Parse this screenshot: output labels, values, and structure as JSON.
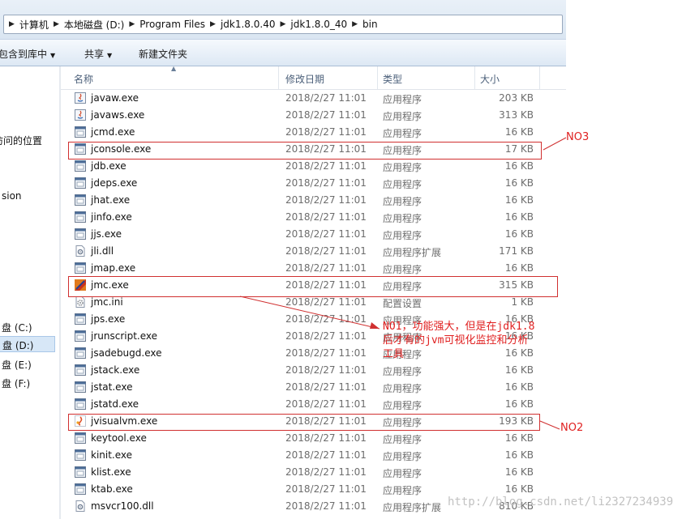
{
  "address": {
    "crumbs": [
      "计算机",
      "本地磁盘 (D:)",
      "Program Files",
      "jdk1.8.0.40",
      "jdk1.8.0_40",
      "bin"
    ]
  },
  "toolbar": {
    "include_library": "包含到库中",
    "share": "共享",
    "new_folder": "新建文件夹"
  },
  "nav": {
    "recent_places": "访问的位置",
    "version": "sion",
    "drive_c": "盘 (C:)",
    "drive_d": "盘 (D:)",
    "drive_e": "盘 (E:)",
    "drive_f": "盘 (F:)"
  },
  "columns": {
    "name": "名称",
    "modified": "修改日期",
    "type": "类型",
    "size": "大小"
  },
  "files": [
    {
      "name": "javaw.exe",
      "date": "2018/2/27 11:01",
      "type": "应用程序",
      "size": "203 KB",
      "icon": "java-icon"
    },
    {
      "name": "javaws.exe",
      "date": "2018/2/27 11:01",
      "type": "应用程序",
      "size": "313 KB",
      "icon": "java-icon"
    },
    {
      "name": "jcmd.exe",
      "date": "2018/2/27 11:01",
      "type": "应用程序",
      "size": "16 KB",
      "icon": "exe-icon"
    },
    {
      "name": "jconsole.exe",
      "date": "2018/2/27 11:01",
      "type": "应用程序",
      "size": "17 KB",
      "icon": "exe-icon"
    },
    {
      "name": "jdb.exe",
      "date": "2018/2/27 11:01",
      "type": "应用程序",
      "size": "16 KB",
      "icon": "exe-icon"
    },
    {
      "name": "jdeps.exe",
      "date": "2018/2/27 11:01",
      "type": "应用程序",
      "size": "16 KB",
      "icon": "exe-icon"
    },
    {
      "name": "jhat.exe",
      "date": "2018/2/27 11:01",
      "type": "应用程序",
      "size": "16 KB",
      "icon": "exe-icon"
    },
    {
      "name": "jinfo.exe",
      "date": "2018/2/27 11:01",
      "type": "应用程序",
      "size": "16 KB",
      "icon": "exe-icon"
    },
    {
      "name": "jjs.exe",
      "date": "2018/2/27 11:01",
      "type": "应用程序",
      "size": "16 KB",
      "icon": "exe-icon"
    },
    {
      "name": "jli.dll",
      "date": "2018/2/27 11:01",
      "type": "应用程序扩展",
      "size": "171 KB",
      "icon": "dll-icon"
    },
    {
      "name": "jmap.exe",
      "date": "2018/2/27 11:01",
      "type": "应用程序",
      "size": "16 KB",
      "icon": "exe-icon"
    },
    {
      "name": "jmc.exe",
      "date": "2018/2/27 11:01",
      "type": "应用程序",
      "size": "315 KB",
      "icon": "jmc-icon"
    },
    {
      "name": "jmc.ini",
      "date": "2018/2/27 11:01",
      "type": "配置设置",
      "size": "1 KB",
      "icon": "ini-icon"
    },
    {
      "name": "jps.exe",
      "date": "2018/2/27 11:01",
      "type": "应用程序",
      "size": "16 KB",
      "icon": "exe-icon"
    },
    {
      "name": "jrunscript.exe",
      "date": "2018/2/27 11:01",
      "type": "应用程序",
      "size": "16 KB",
      "icon": "exe-icon"
    },
    {
      "name": "jsadebugd.exe",
      "date": "2018/2/27 11:01",
      "type": "应用程序",
      "size": "16 KB",
      "icon": "exe-icon"
    },
    {
      "name": "jstack.exe",
      "date": "2018/2/27 11:01",
      "type": "应用程序",
      "size": "16 KB",
      "icon": "exe-icon"
    },
    {
      "name": "jstat.exe",
      "date": "2018/2/27 11:01",
      "type": "应用程序",
      "size": "16 KB",
      "icon": "exe-icon"
    },
    {
      "name": "jstatd.exe",
      "date": "2018/2/27 11:01",
      "type": "应用程序",
      "size": "16 KB",
      "icon": "exe-icon"
    },
    {
      "name": "jvisualvm.exe",
      "date": "2018/2/27 11:01",
      "type": "应用程序",
      "size": "193 KB",
      "icon": "jvisualvm-icon"
    },
    {
      "name": "keytool.exe",
      "date": "2018/2/27 11:01",
      "type": "应用程序",
      "size": "16 KB",
      "icon": "exe-icon"
    },
    {
      "name": "kinit.exe",
      "date": "2018/2/27 11:01",
      "type": "应用程序",
      "size": "16 KB",
      "icon": "exe-icon"
    },
    {
      "name": "klist.exe",
      "date": "2018/2/27 11:01",
      "type": "应用程序",
      "size": "16 KB",
      "icon": "exe-icon"
    },
    {
      "name": "ktab.exe",
      "date": "2018/2/27 11:01",
      "type": "应用程序",
      "size": "16 KB",
      "icon": "exe-icon"
    },
    {
      "name": "msvcr100.dll",
      "date": "2018/2/27 11:01",
      "type": "应用程序扩展",
      "size": "810 KB",
      "icon": "dll-icon"
    }
  ],
  "annotations": {
    "no3": "NO3",
    "no2": "NO2",
    "no1_line1": "NO1，功能强大，但是在jdk1.8",
    "no1_line2": "后才有的jvm可视化监控和分析",
    "no1_line3": "工具",
    "accent": "#d03030"
  },
  "watermark": "http://blog.csdn.net/li2327234939"
}
